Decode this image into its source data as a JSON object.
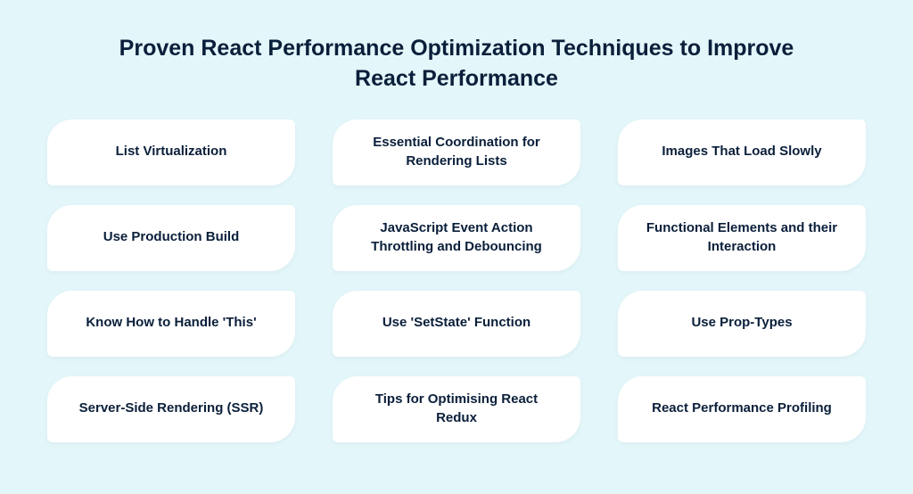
{
  "title": "Proven React Performance Optimization Techniques to Improve React Performance",
  "cards": [
    "List Virtualization",
    "Essential Coordination for Rendering Lists",
    "Images That Load Slowly",
    "Use Production Build",
    "JavaScript Event Action Throttling and Debouncing",
    "Functional Elements and their Interaction",
    "Know How to Handle 'This'",
    "Use 'SetState' Function",
    "Use Prop-Types",
    "Server-Side Rendering (SSR)",
    "Tips for Optimising React Redux",
    "React Performance Profiling"
  ]
}
